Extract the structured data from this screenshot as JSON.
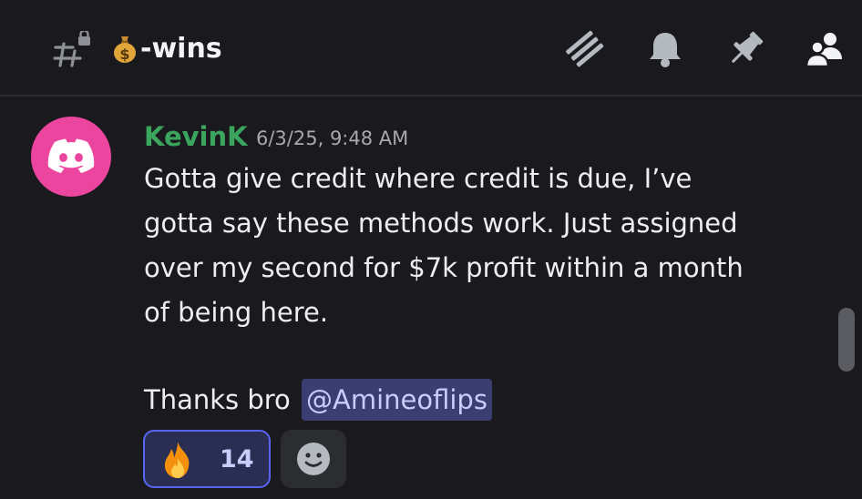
{
  "header": {
    "channel_name": "-wins",
    "channel_emoji": "money-bag",
    "icons": [
      "threads-icon",
      "bell-icon",
      "pin-icon",
      "members-icon"
    ]
  },
  "message": {
    "author": "KevinK",
    "author_color": "#3ba55d",
    "timestamp": "6/3/25, 9:48 AM",
    "lines": [
      "Gotta give credit where credit is due, I’ve",
      "gotta say these methods work. Just assigned",
      "over my second for $7k profit within a month",
      "of being here."
    ],
    "thanks_text": "Thanks bro",
    "mention": "@Amineoflips",
    "avatar_color": "#eb459f"
  },
  "reaction": {
    "emoji": "fire",
    "count": "14"
  },
  "accent": "#5865f2"
}
